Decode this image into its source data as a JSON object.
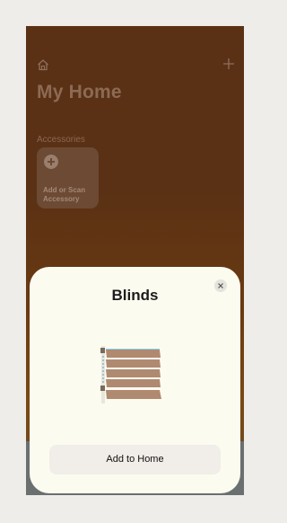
{
  "home": {
    "title": "My Home",
    "section_label": "Accessories",
    "add_tile_label": "Add or Scan Accessory"
  },
  "sheet": {
    "title": "Blinds",
    "add_button_label": "Add to Home"
  },
  "icons": {
    "home": "home-icon",
    "add": "plus-icon",
    "close": "close-icon",
    "blinds": "blinds-icon"
  },
  "colors": {
    "background_brown": "#5b3115",
    "sheet_background": "#fcfbf0",
    "button_background": "#f1ede8"
  }
}
